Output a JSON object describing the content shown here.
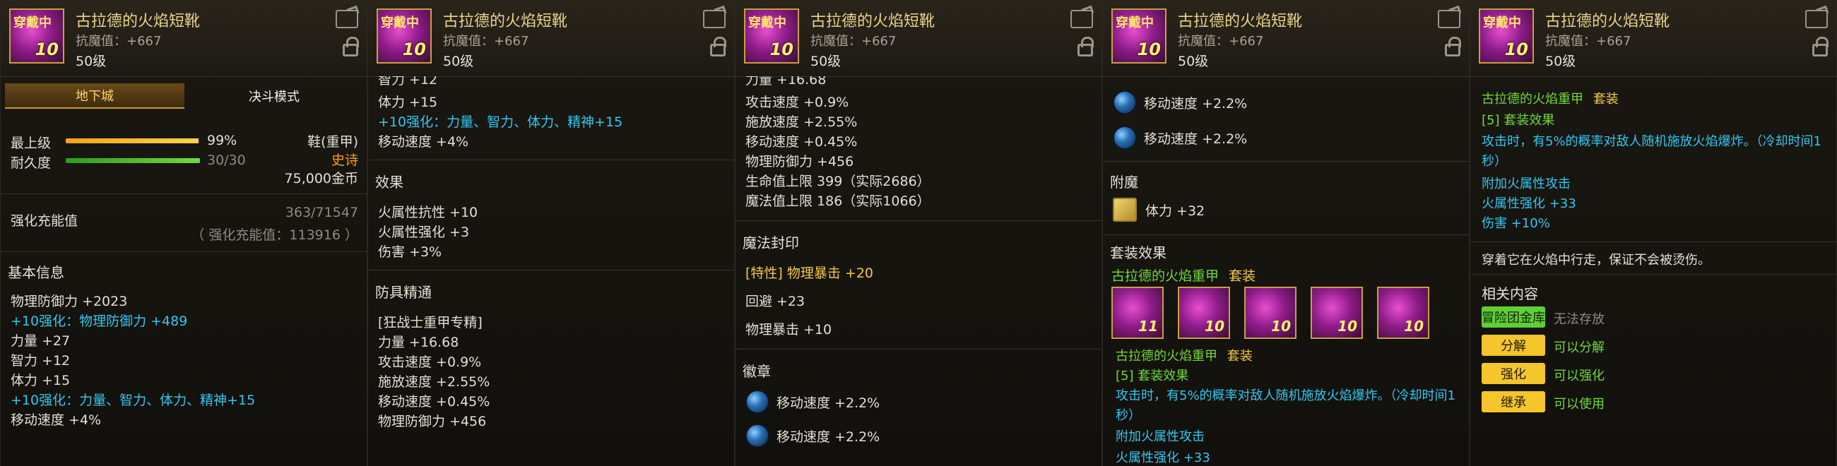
{
  "item": {
    "name": "古拉德的火焰短靴",
    "resist": "抗魔值：+667",
    "level": "50级",
    "badge": "穿戴中",
    "enhance_level": "10"
  },
  "panel1": {
    "tabs": [
      "地下城",
      "决斗模式"
    ],
    "grade_label": "最上级",
    "grade_value": "99%",
    "durability_label": "耐久度",
    "durability_value": "30/30",
    "grade_fill_pct": 99,
    "durability_fill_pct": 100,
    "type": "鞋(重甲)",
    "rarity": "史诗",
    "price": "75,000金币",
    "charge_label": "强化充能值",
    "charge_value": "363/71547",
    "charge_note": "（ 强化充能值：113916 ）",
    "section_basic": "基本信息",
    "lines": [
      {
        "text": "物理防御力 +2023",
        "color": "white"
      },
      {
        "text": "+10强化：物理防御力 +489",
        "color": "cyan"
      },
      {
        "text": "力量 +27",
        "color": "white"
      },
      {
        "text": "智力 +12",
        "color": "white"
      },
      {
        "text": "体力 +15",
        "color": "white"
      },
      {
        "text": "+10强化：力量、智力、体力、精神+15",
        "color": "cyan"
      },
      {
        "text": "移动速度 +4%",
        "color": "white"
      }
    ]
  },
  "panel2": {
    "top_partial": "智力 +12",
    "lines_top": [
      {
        "text": "体力 +15",
        "color": "white"
      },
      {
        "text": "+10强化：力量、智力、体力、精神+15",
        "color": "cyan"
      },
      {
        "text": "移动速度 +4%",
        "color": "white"
      }
    ],
    "section_effect": "效果",
    "effect_lines": [
      "火属性抗性 +10",
      "火属性强化 +3",
      "伤害 +3%"
    ],
    "section_mastery": "防具精通",
    "mastery_lines": [
      "[狂战士重甲专精]",
      "力量 +16.68",
      "攻击速度 +0.9%",
      "施放速度 +2.55%",
      "移动速度 +0.45%",
      "物理防御力 +456"
    ]
  },
  "panel3": {
    "top_partial": "力量 +16.68",
    "lines": [
      "攻击速度 +0.9%",
      "施放速度 +2.55%",
      "移动速度 +0.45%",
      "物理防御力 +456",
      "生命值上限 399（实际2686）",
      "魔法值上限 186（实际1066）"
    ],
    "section_seal": "魔法封印",
    "seal_lines": [
      {
        "text": "[特性] 物理暴击 +20",
        "color": "yellow"
      },
      {
        "text": "回避 +23",
        "color": "white"
      },
      {
        "text": "物理暴击 +10",
        "color": "white"
      }
    ],
    "section_emblem": "徽章",
    "emblems": [
      "移动速度 +2.2%",
      "移动速度 +2.2%"
    ]
  },
  "panel4": {
    "emblems": [
      "移动速度 +2.2%",
      "移动速度 +2.2%"
    ],
    "section_enchant": "附魔",
    "enchant": "体力 +32",
    "section_set": "套装效果",
    "set_name": "古拉德的火焰重甲",
    "set_tag": "套装",
    "set_icon_levels": [
      "11",
      "10",
      "10",
      "10",
      "10"
    ],
    "set_name2": "古拉德的火焰重甲",
    "set_tag2": "套装",
    "set_bonus_title": "[5] 套装效果",
    "set_bonus_text1": "攻击时，有5%的概率对敌人随机施放火焰爆炸。（冷却时间1",
    "set_bonus_text2": "秒）",
    "set_extra": "附加火属性攻击",
    "set_extra_partial": "火属性强化 +33"
  },
  "panel5": {
    "set_name": "古拉德的火焰重甲",
    "set_tag": "套装",
    "set_bonus_title": "[5] 套装效果",
    "set_bonus_text1": "攻击时，有5%的概率对敌人随机施放火焰爆炸。（冷却时间1",
    "set_bonus_text2": "秒）",
    "set_extra": "附加火属性攻击",
    "fire_boost": "火属性强化 +33",
    "damage": "伤害 +10%",
    "flavor": "穿着它在火焰中行走，保证不会被烫伤。",
    "section_related": "相关内容",
    "related": [
      {
        "button": "冒险团金库",
        "text": "无法存放",
        "style": "green",
        "text_color": "gray"
      },
      {
        "button": "分解",
        "text": "可以分解",
        "style": "yellow",
        "text_color": "green"
      },
      {
        "button": "强化",
        "text": "可以强化",
        "style": "yellow",
        "text_color": "green"
      },
      {
        "button": "继承",
        "text": "可以使用",
        "style": "yellow",
        "text_color": "green"
      }
    ]
  }
}
